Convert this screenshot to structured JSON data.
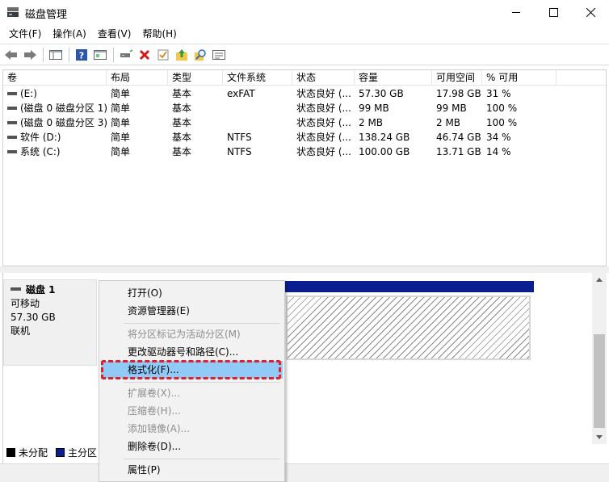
{
  "window": {
    "title": "磁盘管理",
    "icon": "disk-management-icon"
  },
  "menubar": {
    "items": [
      "文件(F)",
      "操作(A)",
      "查看(V)",
      "帮助(H)"
    ]
  },
  "toolbar": {
    "icons": [
      "back-arrow-icon",
      "forward-arrow-icon",
      "console-tree-icon",
      "help-icon",
      "properties-icon",
      "connect-drive-icon",
      "delete-icon",
      "checklist-icon",
      "folder-up-icon",
      "search-icon",
      "properties-sheet-icon"
    ]
  },
  "volume_list": {
    "columns": [
      "卷",
      "布局",
      "类型",
      "文件系统",
      "状态",
      "容量",
      "可用空间",
      "% 可用"
    ],
    "rows": [
      [
        "(E:)",
        "简单",
        "基本",
        "exFAT",
        "状态良好 (...",
        "57.30 GB",
        "17.98 GB",
        "31 %"
      ],
      [
        "(磁盘 0 磁盘分区 1)",
        "简单",
        "基本",
        "",
        "状态良好 (...",
        "99 MB",
        "99 MB",
        "100 %"
      ],
      [
        "(磁盘 0 磁盘分区 3)",
        "简单",
        "基本",
        "",
        "状态良好 (...",
        "2 MB",
        "2 MB",
        "100 %"
      ],
      [
        "软件 (D:)",
        "简单",
        "基本",
        "NTFS",
        "状态良好 (...",
        "138.24 GB",
        "46.74 GB",
        "34 %"
      ],
      [
        "系统 (C:)",
        "简单",
        "基本",
        "NTFS",
        "状态良好 (...",
        "100.00 GB",
        "13.71 GB",
        "14 %"
      ]
    ]
  },
  "disk": {
    "name": "磁盘 1",
    "type": "可移动",
    "size": "57.30 GB",
    "status": "联机"
  },
  "legend": {
    "items": [
      {
        "label": "未分配",
        "color": "#000000"
      },
      {
        "label": "主分区",
        "color": "#0a1f8f"
      }
    ]
  },
  "context_menu": {
    "items": [
      {
        "label": "打开(O)",
        "enabled": true
      },
      {
        "label": "资源管理器(E)",
        "enabled": true
      },
      {
        "label": "将分区标记为活动分区(M)",
        "enabled": false
      },
      {
        "label": "更改驱动器号和路径(C)...",
        "enabled": true
      },
      {
        "label": "格式化(F)...",
        "enabled": true,
        "highlighted": true
      },
      {
        "label": "扩展卷(X)...",
        "enabled": false
      },
      {
        "label": "压缩卷(H)...",
        "enabled": false
      },
      {
        "label": "添加镜像(A)...",
        "enabled": false
      },
      {
        "label": "删除卷(D)...",
        "enabled": true
      },
      {
        "label": "属性(P)",
        "enabled": true
      }
    ]
  },
  "colors": {
    "primary_partition": "#0a1f8f",
    "highlight": "#91c9f7",
    "focus_outline": "#e0202a"
  }
}
